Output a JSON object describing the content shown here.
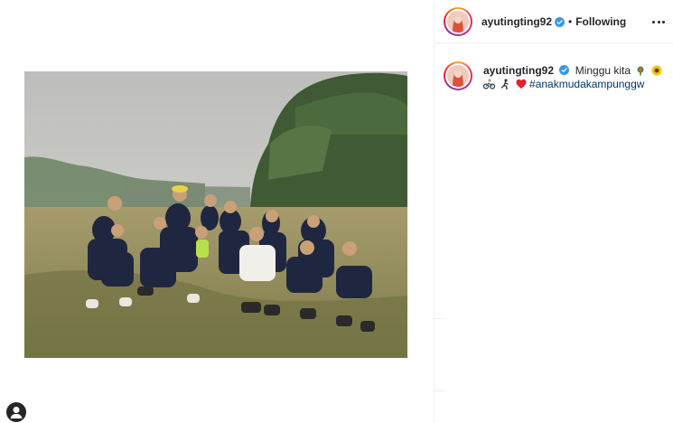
{
  "post": {
    "username": "ayutingting92",
    "separator": "•",
    "follow_status": "Following",
    "more_icon": "more-horizontal-icon",
    "verified_icon": "verified-badge-icon",
    "caption_text": "Minggu kita",
    "caption_emojis": [
      "pushpin-flower-emoji",
      "sunflower-emoji",
      "bicyclist-emoji",
      "runner-emoji",
      "heart-emoji"
    ],
    "hashtag": "#anakmudakampunggw"
  },
  "colors": {
    "accent_link": "#00376b",
    "verified": "#3897f0",
    "text": "#262626",
    "divider": "#efefef"
  },
  "media": {
    "alt_icon": "group-photo-image"
  },
  "bottom": {
    "profile_icon": "profile-avatar-icon"
  }
}
